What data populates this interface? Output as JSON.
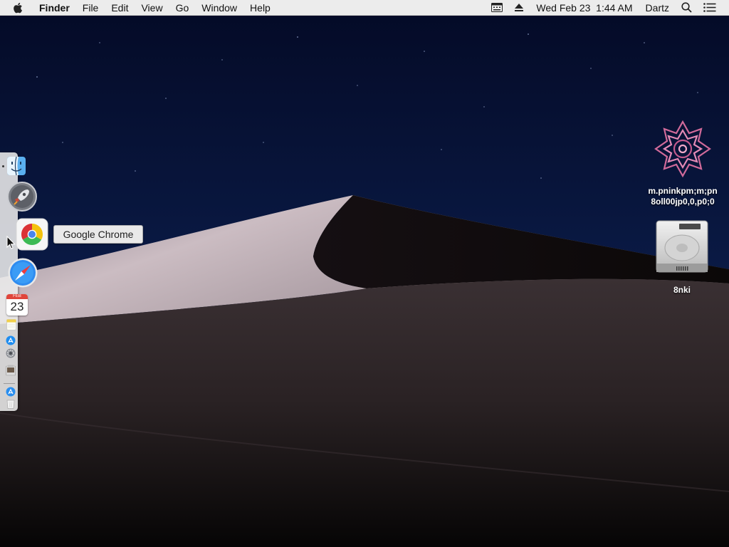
{
  "menubar": {
    "app_name": "Finder",
    "menus": [
      "File",
      "Edit",
      "View",
      "Go",
      "Window",
      "Help"
    ],
    "clock": "Wed Feb 23  1:44 AM",
    "user": "Dartz",
    "icons": [
      "apple-icon",
      "keyboard-viewer-icon",
      "eject-icon",
      "spotlight-search-icon",
      "notification-center-icon"
    ]
  },
  "dock": {
    "items": [
      "finder",
      "launchpad",
      "google-chrome",
      "safari",
      "calendar",
      "notes",
      "app-store",
      "system-preferences",
      "preview",
      "downloads",
      "trash"
    ],
    "calendar_month": "FEB",
    "calendar_day": "23",
    "tooltip": "Google Chrome"
  },
  "desktop": {
    "icons": [
      {
        "kind": "pink-mandala-image",
        "label": "m.pninkpm;m;pn 8oll00jp0,0,p0;0"
      },
      {
        "kind": "hard-drive",
        "label": "8nki"
      }
    ]
  },
  "colors": {
    "sky": "#061033",
    "dune_light": "#c8b8be",
    "dune_dark": "#221a1c",
    "menubar": "#ececec"
  }
}
